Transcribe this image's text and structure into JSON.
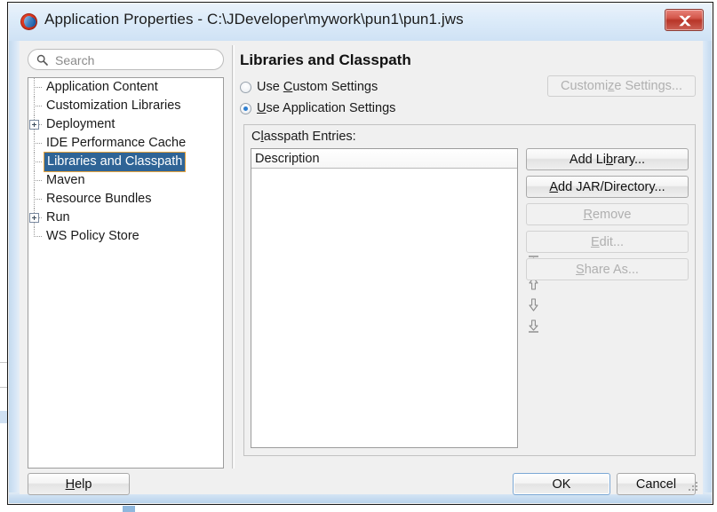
{
  "window": {
    "title": "Application Properties - C:\\JDeveloper\\mywork\\pun1\\pun1.jws",
    "app_icon": "jdeveloper-icon",
    "close_label": "Close",
    "accent_blue": "#2f6496",
    "selection_border": "#e8a33d",
    "focus_blue": "#7ba7d4",
    "close_red": "#b83528"
  },
  "search": {
    "placeholder": "Search",
    "value": "",
    "icon": "search-icon"
  },
  "tree": {
    "items": [
      {
        "label": "Application Content",
        "expandable": false,
        "selected": false
      },
      {
        "label": "Customization Libraries",
        "expandable": false,
        "selected": false
      },
      {
        "label": "Deployment",
        "expandable": true,
        "selected": false
      },
      {
        "label": "IDE Performance Cache",
        "expandable": false,
        "selected": false
      },
      {
        "label": "Libraries and Classpath",
        "expandable": false,
        "selected": true
      },
      {
        "label": "Maven",
        "expandable": false,
        "selected": false
      },
      {
        "label": "Resource Bundles",
        "expandable": false,
        "selected": false
      },
      {
        "label": "Run",
        "expandable": true,
        "selected": false
      },
      {
        "label": "WS Policy Store",
        "expandable": false,
        "selected": false
      }
    ]
  },
  "panel": {
    "title": "Libraries and Classpath",
    "radios": [
      {
        "label_pre": "Use ",
        "mnemonic": "C",
        "label_post": "ustom Settings",
        "checked": false
      },
      {
        "label_pre": "",
        "mnemonic": "U",
        "label_post": "se Application Settings",
        "checked": true
      }
    ],
    "customize_button": {
      "label_pre": "Customi",
      "mnemonic": "z",
      "label_post": "e Settings...",
      "enabled": false
    },
    "group_label_pre": "C",
    "group_label_mnemonic": "l",
    "group_label_post": "asspath Entries:",
    "table": {
      "columns": [
        "Description"
      ],
      "rows": []
    },
    "order_buttons": [
      {
        "name": "move-to-top",
        "glyph": "up-bar"
      },
      {
        "name": "move-up",
        "glyph": "up"
      },
      {
        "name": "move-down",
        "glyph": "down"
      },
      {
        "name": "move-to-bottom",
        "glyph": "down-bar"
      }
    ],
    "action_buttons": [
      {
        "label_pre": "Add Li",
        "mnemonic": "b",
        "label_post": "rary...",
        "enabled": true
      },
      {
        "label_pre": "",
        "mnemonic": "A",
        "label_post": "dd JAR/Directory...",
        "enabled": true
      },
      {
        "label_pre": "",
        "mnemonic": "R",
        "label_post": "emove",
        "enabled": false
      },
      {
        "label_pre": "",
        "mnemonic": "E",
        "label_post": "dit...",
        "enabled": false
      },
      {
        "label_pre": "",
        "mnemonic": "S",
        "label_post": "hare As...",
        "enabled": false
      }
    ]
  },
  "footer": {
    "help": {
      "label_pre": "H",
      "mnemonic": "",
      "label_post": "elp",
      "mnemonic_char": "H"
    },
    "ok": "OK",
    "cancel": "Cancel"
  }
}
